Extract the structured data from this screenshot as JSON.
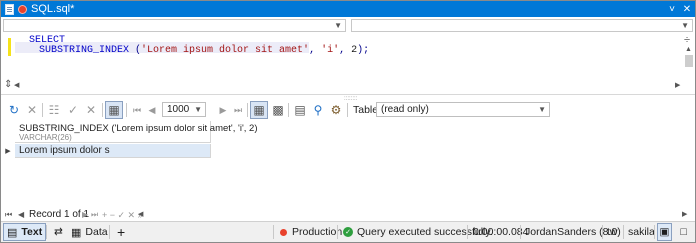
{
  "window": {
    "title": "SQL.sql*",
    "controls": {
      "chevron": "˅",
      "close": "✕"
    }
  },
  "editor": {
    "lines": [
      "SELECT",
      "SUBSTRING_INDEX ('Lorem ipsum dolor sit amet', 'i', 2);"
    ],
    "parts": {
      "kw_select": "SELECT",
      "fn": "SUBSTRING_INDEX",
      "open": " (",
      "s1": "'Lorem ipsum dolor sit amet'",
      "comma1": ", ",
      "s2": "'i'",
      "comma2": ", ",
      "n": "2",
      "close": ");"
    },
    "scroll_split": "÷",
    "splitter_grip": "::::::::"
  },
  "grid_toolbar": {
    "limit_value": "1000",
    "table_label": "Table",
    "table_value": "(read only)"
  },
  "result": {
    "column_name": "SUBSTRING_INDEX ('Lorem ipsum dolor sit amet', 'i', 2)",
    "column_type": "VARCHAR(26)",
    "rows": [
      "Lorem ipsum dolor s"
    ]
  },
  "record_nav": {
    "text": "Record 1 of 1",
    "controls": "+ − ✓ ✕ »"
  },
  "status_bar": {
    "text_tab": "Text",
    "data_tab": "Data",
    "add": "+",
    "environment": "Production",
    "message": "Query executed successfully.",
    "duration": "0:00:00.084",
    "user": "JordanSanders (8.0)",
    "short": "tw",
    "database": "sakila"
  },
  "colors": {
    "accent": "#0078d7",
    "selected_cell": "#dde9f7",
    "production_dot": "#e8412c",
    "success": "#2e9e3e"
  }
}
